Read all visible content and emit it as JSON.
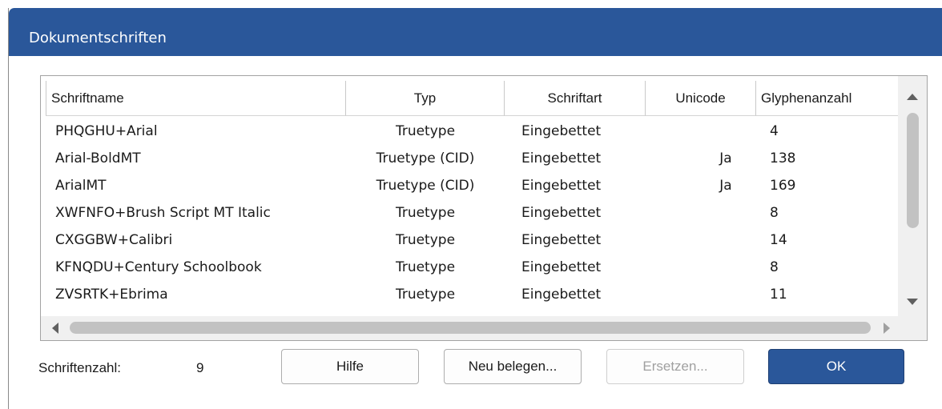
{
  "window": {
    "title": "Dokumentschriften"
  },
  "table": {
    "columns": [
      "Schriftname",
      "Typ",
      "Schriftart",
      "Unicode",
      "Glyphenanzahl"
    ],
    "rows": [
      {
        "name": "PHQGHU+Arial",
        "typ": "Truetype",
        "art": "Eingebettet",
        "unicode": "",
        "glyphs": "4"
      },
      {
        "name": "Arial-BoldMT",
        "typ": "Truetype (CID)",
        "art": "Eingebettet",
        "unicode": "Ja",
        "glyphs": "138"
      },
      {
        "name": "ArialMT",
        "typ": "Truetype (CID)",
        "art": "Eingebettet",
        "unicode": "Ja",
        "glyphs": "169"
      },
      {
        "name": "XWFNFO+Brush Script MT Italic",
        "typ": "Truetype",
        "art": "Eingebettet",
        "unicode": "",
        "glyphs": "8"
      },
      {
        "name": "CXGGBW+Calibri",
        "typ": "Truetype",
        "art": "Eingebettet",
        "unicode": "",
        "glyphs": "14"
      },
      {
        "name": "KFNQDU+Century Schoolbook",
        "typ": "Truetype",
        "art": "Eingebettet",
        "unicode": "",
        "glyphs": "8"
      },
      {
        "name": "ZVSRTK+Ebrima",
        "typ": "Truetype",
        "art": "Eingebettet",
        "unicode": "",
        "glyphs": "11"
      }
    ]
  },
  "footer": {
    "count_label": "Schriftenzahl:",
    "count_value": "9",
    "help_label": "Hilfe",
    "remap_label": "Neu belegen...",
    "replace_label": "Ersetzen...",
    "ok_label": "OK"
  },
  "colors": {
    "accent": "#2a579a"
  }
}
